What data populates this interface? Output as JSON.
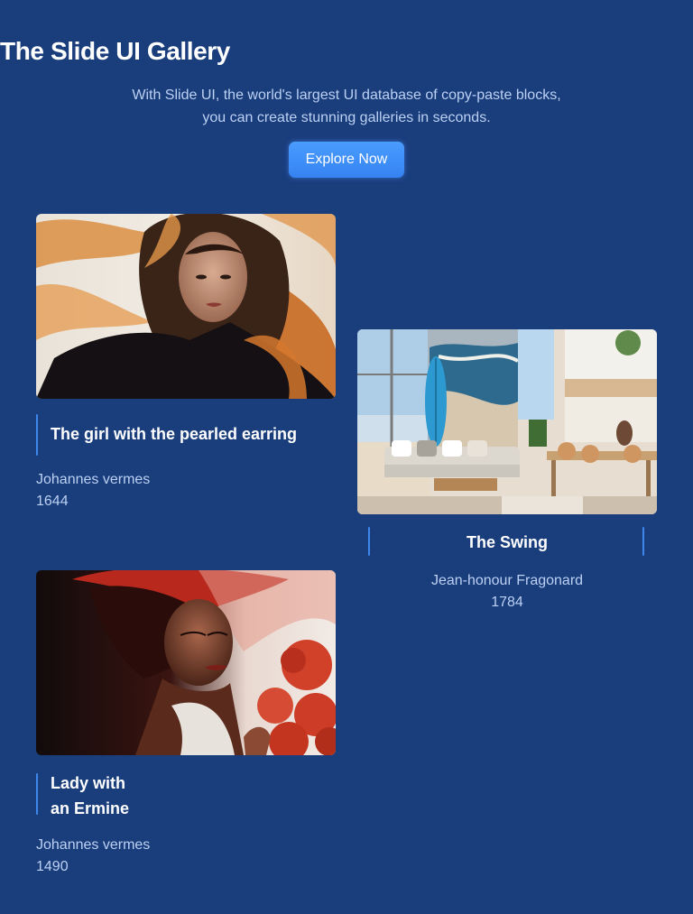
{
  "header": {
    "title": "The Slide UI Gallery",
    "subtitle_line1": "With Slide UI, the world's largest UI database of copy-paste blocks,",
    "subtitle_line2": "you can create stunning galleries in seconds.",
    "cta_label": "Explore Now"
  },
  "colors": {
    "background": "#1a3d7c",
    "accent": "#3d86ec",
    "button": "#3f8ff7",
    "muted_text": "#bcd1f3"
  },
  "gallery": [
    {
      "title": "The girl with the pearled earring",
      "artist": "Johannes vermes",
      "year": "1644",
      "image": "portrait-woman-flowing-hair"
    },
    {
      "title": "The Swing",
      "artist": "Jean-honour Fragonard",
      "year": "1784",
      "image": "beach-house-interior"
    },
    {
      "title_line1": "Lady with",
      "title_line2": "an Ermine",
      "artist": "Johannes vermes",
      "year": "1490",
      "image": "portrait-woman-red-scarf-roses"
    }
  ]
}
